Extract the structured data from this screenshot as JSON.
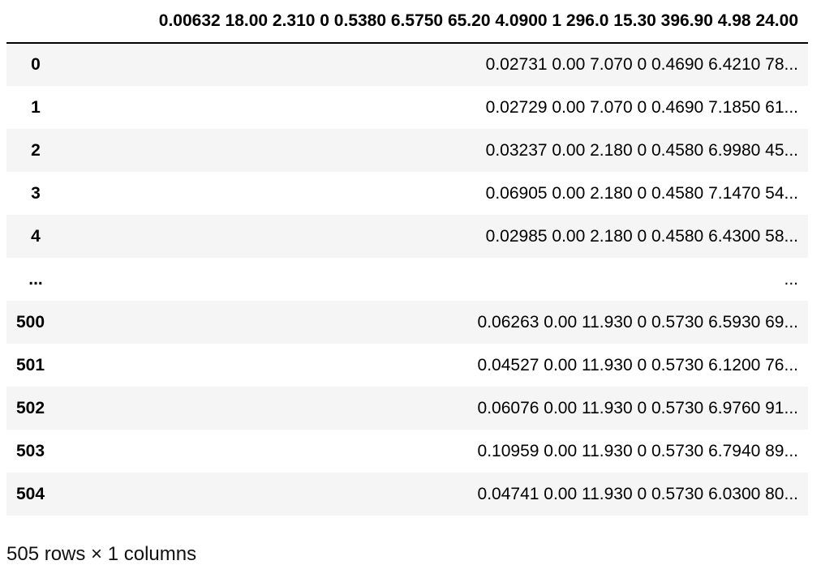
{
  "dataframe": {
    "column_header": "0.00632 18.00 2.310 0 0.5380 6.5750 65.20 4.0900 1 296.0 15.30 396.90 4.98 24.00",
    "index_header": "",
    "rows": [
      {
        "index": "0",
        "value": "0.02731 0.00 7.070 0 0.4690 6.4210 78..."
      },
      {
        "index": "1",
        "value": "0.02729 0.00 7.070 0 0.4690 7.1850 61..."
      },
      {
        "index": "2",
        "value": "0.03237 0.00 2.180 0 0.4580 6.9980 45..."
      },
      {
        "index": "3",
        "value": "0.06905 0.00 2.180 0 0.4580 7.1470 54..."
      },
      {
        "index": "4",
        "value": "0.02985 0.00 2.180 0 0.4580 6.4300 58..."
      },
      {
        "index": "...",
        "value": "..."
      },
      {
        "index": "500",
        "value": "0.06263 0.00 11.930 0 0.5730 6.5930 69..."
      },
      {
        "index": "501",
        "value": "0.04527 0.00 11.930 0 0.5730 6.1200 76..."
      },
      {
        "index": "502",
        "value": "0.06076 0.00 11.930 0 0.5730 6.9760 91..."
      },
      {
        "index": "503",
        "value": "0.10959 0.00 11.930 0 0.5730 6.7940 89..."
      },
      {
        "index": "504",
        "value": "0.04741 0.00 11.930 0 0.5730 6.0300 80..."
      }
    ],
    "shape_caption": "505 rows × 1 columns"
  },
  "colors": {
    "striped_row": "#f5f5f5",
    "header_rule": "#000000"
  }
}
